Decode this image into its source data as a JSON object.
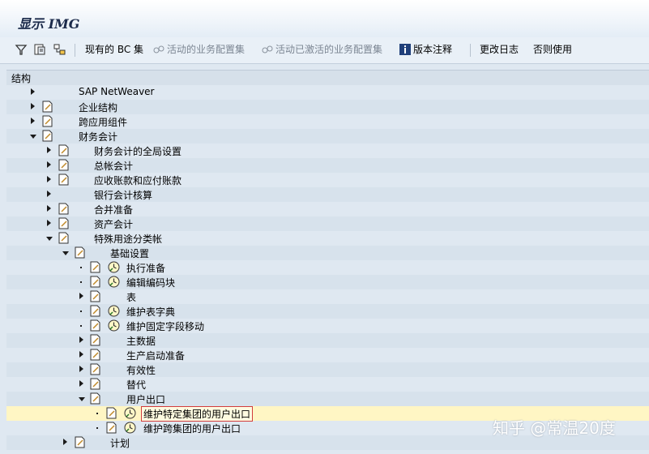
{
  "window": {
    "title": "显示 IMG"
  },
  "toolbar": {
    "bc_sets": "现有的 BC 集",
    "activity_bc_sets": "活动的业务配置集",
    "activated_bc_sets": "活动已激活的业务配置集",
    "release_notes": "版本注释",
    "change_log": "更改日志",
    "usage": "否则使用"
  },
  "tree": {
    "header": "结构",
    "nodes": [
      {
        "label": "SAP NetWeaver"
      },
      {
        "label": "企业结构"
      },
      {
        "label": "跨应用组件"
      },
      {
        "label": "财务会计"
      },
      {
        "label": "财务会计的全局设置"
      },
      {
        "label": "总帐会计"
      },
      {
        "label": "应收账款和应付账款"
      },
      {
        "label": "银行会计核算"
      },
      {
        "label": "合并准备"
      },
      {
        "label": "资产会计"
      },
      {
        "label": "特殊用途分类帐"
      },
      {
        "label": "基础设置"
      },
      {
        "label": "执行准备"
      },
      {
        "label": "编辑编码块"
      },
      {
        "label": "表"
      },
      {
        "label": "维护表字典"
      },
      {
        "label": "维护固定字段移动"
      },
      {
        "label": "主数据"
      },
      {
        "label": "生产启动准备"
      },
      {
        "label": "有效性"
      },
      {
        "label": "替代"
      },
      {
        "label": "用户出口"
      },
      {
        "label": "维护特定集团的用户出口"
      },
      {
        "label": "维护跨集团的用户出口"
      },
      {
        "label": "计划"
      }
    ]
  },
  "watermark": "知乎 @常温20度"
}
